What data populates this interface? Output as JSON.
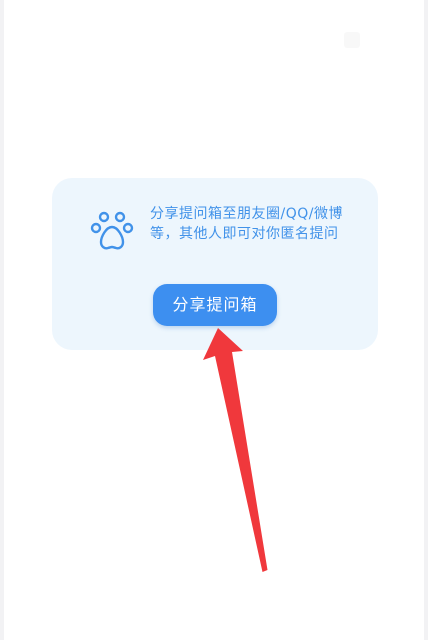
{
  "card": {
    "tip": "分享提问箱至朋友圈/QQ/微博等，其他人即可对你匿名提问",
    "button_label": "分享提问箱"
  },
  "icons": {
    "tip_icon": "paw-icon"
  },
  "colors": {
    "accent": "#3d8ff0",
    "card_bg": "#edf6fd",
    "tip_text": "#4192e9",
    "annotation_arrow": "#f0383c"
  }
}
